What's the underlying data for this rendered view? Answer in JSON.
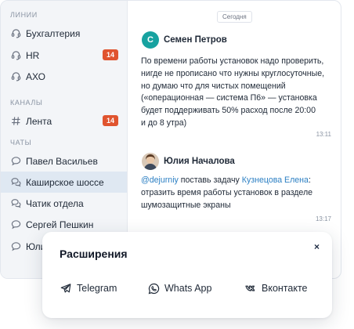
{
  "sidebar": {
    "sections": {
      "lines": "ЛИНИИ",
      "channels": "КАНАЛЫ",
      "chats": "ЧАТЫ"
    },
    "lines": [
      {
        "label": "Бухгалтерия",
        "icon": "headset-icon"
      },
      {
        "label": "HR",
        "icon": "headset-icon",
        "badge": "14"
      },
      {
        "label": "АХО",
        "icon": "headset-icon"
      }
    ],
    "channels": [
      {
        "label": "Лента",
        "icon": "hash-icon",
        "badge": "14"
      }
    ],
    "chats": [
      {
        "label": "Павел Васильев",
        "icon": "chat-bubble-icon"
      },
      {
        "label": "Каширское шоссе",
        "icon": "chat-bubbles-icon",
        "active": true
      },
      {
        "label": "Чатик отдела",
        "icon": "chat-bubbles-icon"
      },
      {
        "label": "Сергей Пешкин",
        "icon": "chat-bubble-icon"
      },
      {
        "label": "Юлия",
        "icon": "chat-bubble-icon"
      }
    ]
  },
  "chat": {
    "date": "Сегодня",
    "messages": [
      {
        "avatar_letter": "С",
        "author": "Семен Петров",
        "lines": [
          "По времени работы установок надо проверить,",
          "нигде не прописано что нужны круглосуточные,",
          "но думаю что для чистых помещений",
          "(«операционная — система П6» — установка",
          "будет поддерживать 50% расход после 20:00",
          "и до 8 утра)"
        ],
        "time": "13:11"
      },
      {
        "author": "Юлия Началова",
        "mention": "@dejurniy",
        "text_a": " поставь задачу ",
        "assignee": "Кузнецова Елена",
        "text_b": ":",
        "line2": "отразить время работы установок в разделе",
        "line3": "шумозащитные экраны",
        "time": "13:17"
      }
    ]
  },
  "popup": {
    "title": "Расширения",
    "close": "×",
    "extensions": [
      {
        "label": "Telegram",
        "icon": "telegram-icon"
      },
      {
        "label": "Whats App",
        "icon": "whatsapp-icon"
      },
      {
        "label": "Вконтакте",
        "icon": "vk-icon"
      }
    ]
  },
  "colors": {
    "badge": "#e0542f",
    "avatar": "#17a2a0",
    "link": "#2b7fc3",
    "active_row": "#dfe8f2"
  }
}
